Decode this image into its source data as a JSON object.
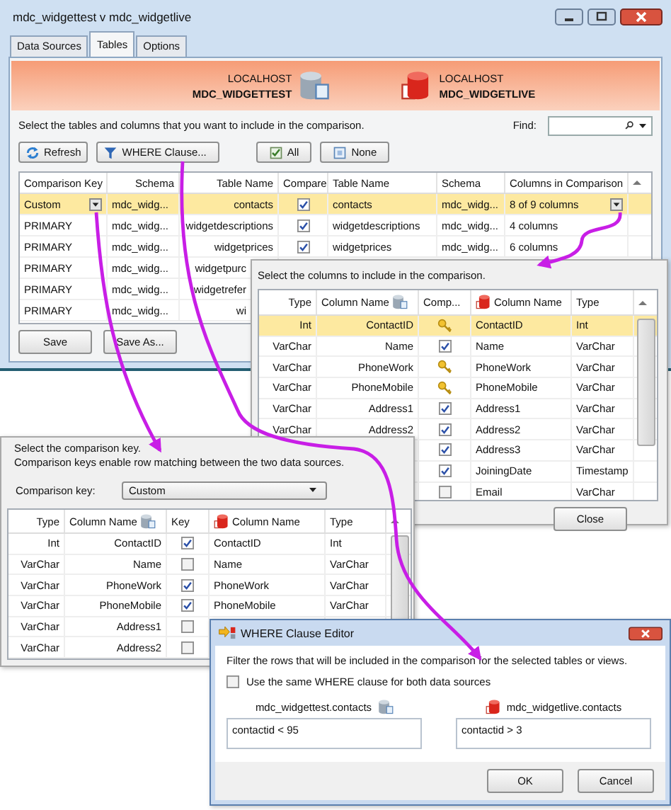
{
  "window": {
    "title": "mdc_widgettest v mdc_widgetlive",
    "tabs": [
      {
        "label": "Data Sources",
        "selected": false
      },
      {
        "label": "Tables",
        "selected": true
      },
      {
        "label": "Options",
        "selected": false
      }
    ]
  },
  "banner": {
    "sources": [
      {
        "host": "LOCALHOST",
        "database": "MDC_WIDGETTEST",
        "kind": "test"
      },
      {
        "host": "LOCALHOST",
        "database": "MDC_WIDGETLIVE",
        "kind": "live"
      }
    ]
  },
  "instructions": "Select the tables and columns that you want to include in the comparison.",
  "find": {
    "label": "Find:"
  },
  "toolbar": [
    {
      "label": "Refresh",
      "kind": "refresh"
    },
    {
      "label": "WHERE Clause...",
      "kind": "filter"
    },
    {
      "label": "All",
      "kind": "all"
    },
    {
      "label": "None",
      "kind": "none"
    }
  ],
  "tables": {
    "columns": [
      "Comparison Key",
      "Schema",
      "Table Name",
      "Compare",
      "Table Name",
      "Schema",
      "Columns in Comparison"
    ],
    "rows": [
      {
        "selected": true,
        "key": "Custom",
        "schema": "mdc_widg...",
        "table": "contacts",
        "compare": true,
        "target_table": "contacts",
        "target_schema": "mdc_widg...",
        "columns": "8 of 9 columns"
      },
      {
        "selected": false,
        "key": "PRIMARY",
        "schema": "mdc_widg...",
        "table": "widgetdescriptions",
        "compare": true,
        "target_table": "widgetdescriptions",
        "target_schema": "mdc_widg...",
        "columns": "4 columns"
      },
      {
        "selected": false,
        "key": "PRIMARY",
        "schema": "mdc_widg...",
        "table": "widgetprices",
        "compare": true,
        "target_table": "widgetprices",
        "target_schema": "mdc_widg...",
        "columns": "6 columns"
      },
      {
        "selected": false,
        "key": "PRIMARY",
        "schema": "mdc_widg...",
        "table": "widgetpurc"
      },
      {
        "selected": false,
        "key": "PRIMARY",
        "schema": "mdc_widg...",
        "table": "widgetrefer"
      },
      {
        "selected": false,
        "key": "PRIMARY",
        "schema": "mdc_widg...",
        "table": "wi"
      }
    ]
  },
  "buttons": [
    "Save",
    "Save As..."
  ],
  "column_picker": {
    "instructions": "Select the columns to include in the comparison.",
    "columns": [
      "Type",
      "Column Name",
      "Comp...",
      "Column Name",
      "Type"
    ],
    "rows": [
      {
        "selected": true,
        "type": "Int",
        "name": "ContactID",
        "kind": "key",
        "target_name": "ContactID",
        "target_type": "Int"
      },
      {
        "selected": false,
        "type": "VarChar",
        "name": "Name",
        "kind": "checkbox",
        "checked": true,
        "target_name": "Name",
        "target_type": "VarChar"
      },
      {
        "selected": false,
        "type": "VarChar",
        "name": "PhoneWork",
        "kind": "key",
        "target_name": "PhoneWork",
        "target_type": "VarChar"
      },
      {
        "selected": false,
        "type": "VarChar",
        "name": "PhoneMobile",
        "kind": "key",
        "target_name": "PhoneMobile",
        "target_type": "VarChar"
      },
      {
        "selected": false,
        "type": "VarChar",
        "name": "Address1",
        "kind": "checkbox",
        "checked": true,
        "target_name": "Address1",
        "target_type": "VarChar"
      },
      {
        "selected": false,
        "type": "VarChar",
        "name": "Address2",
        "kind": "checkbox",
        "checked": true,
        "target_name": "Address2",
        "target_type": "VarChar"
      },
      {
        "selected": false,
        "kind": "checkbox",
        "checked": true,
        "target_name": "Address3",
        "target_type": "VarChar"
      },
      {
        "selected": false,
        "kind": "checkbox",
        "checked": true,
        "target_name": "JoiningDate",
        "target_type": "Timestamp"
      },
      {
        "selected": false,
        "kind": "checkbox",
        "checked": false,
        "target_name": "Email",
        "target_type": "VarChar"
      }
    ],
    "close": "Close"
  },
  "key_picker": {
    "instructions": [
      "Select the comparison key.",
      "Comparison keys enable row matching between the two data sources."
    ],
    "key_label": "Comparison key:",
    "key_value": "Custom",
    "columns": [
      "Type",
      "Column Name",
      "Key",
      "Column Name",
      "Type"
    ],
    "rows": [
      {
        "type": "Int",
        "name": "ContactID",
        "key": true,
        "target_name": "ContactID",
        "target_type": "Int"
      },
      {
        "type": "VarChar",
        "name": "Name",
        "key": false,
        "target_name": "Name",
        "target_type": "VarChar"
      },
      {
        "type": "VarChar",
        "name": "PhoneWork",
        "key": true,
        "target_name": "PhoneWork",
        "target_type": "VarChar"
      },
      {
        "type": "VarChar",
        "name": "PhoneMobile",
        "key": true,
        "target_name": "PhoneMobile",
        "target_type": "VarChar"
      },
      {
        "type": "VarChar",
        "name": "Address1",
        "key": false
      },
      {
        "type": "VarChar",
        "name": "Address2",
        "key": false
      }
    ]
  },
  "where_editor": {
    "title": "WHERE Clause Editor",
    "instructions": "Filter the rows that will be included in the comparison for the selected tables or views.",
    "same_clause": {
      "label": "Use the same WHERE clause for both data sources",
      "checked": false
    },
    "sources": [
      {
        "label": "mdc_widgettest.contacts",
        "kind": "test",
        "value": "contactid < 95"
      },
      {
        "label": "mdc_widgetlive.contacts",
        "kind": "live",
        "value": "contactid > 3"
      }
    ],
    "buttons": [
      "OK",
      "Cancel"
    ]
  }
}
